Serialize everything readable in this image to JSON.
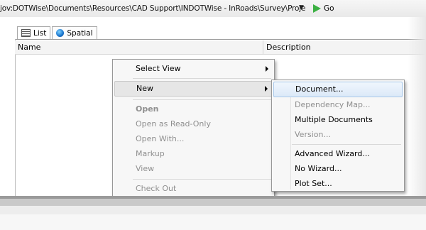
{
  "address_bar": {
    "path": "jov:DOTWise\\Documents\\Resources\\CAD Support\\INDOTWise - InRoads\\Survey\\Proje",
    "dropdown_glyph": "▼",
    "go_label": "Go",
    "go_icon": "green-play-icon"
  },
  "tabs": [
    {
      "label": "List",
      "icon": "list-icon"
    },
    {
      "label": "Spatial",
      "icon": "globe-icon"
    }
  ],
  "columns": {
    "name": "Name",
    "description": "Description"
  },
  "context_menu": {
    "items": [
      {
        "label": "Select View",
        "submenu": true
      },
      {
        "label": "New",
        "submenu": true,
        "highlighted": true
      },
      {
        "label": "Open",
        "disabled": true,
        "bold": true
      },
      {
        "label": "Open as Read-Only",
        "disabled": true
      },
      {
        "label": "Open With...",
        "disabled": true
      },
      {
        "label": "Markup",
        "disabled": true
      },
      {
        "label": "View",
        "disabled": true
      },
      {
        "label": "Check Out",
        "disabled": true
      }
    ]
  },
  "submenu": {
    "items": [
      {
        "label": "Document...",
        "highlighted": true
      },
      {
        "label": "Dependency Map...",
        "disabled": true
      },
      {
        "label": "Multiple Documents"
      },
      {
        "label": "Version...",
        "disabled": true
      },
      {
        "label": "Advanced Wizard..."
      },
      {
        "label": "No Wizard..."
      },
      {
        "label": "Plot Set..."
      }
    ]
  }
}
